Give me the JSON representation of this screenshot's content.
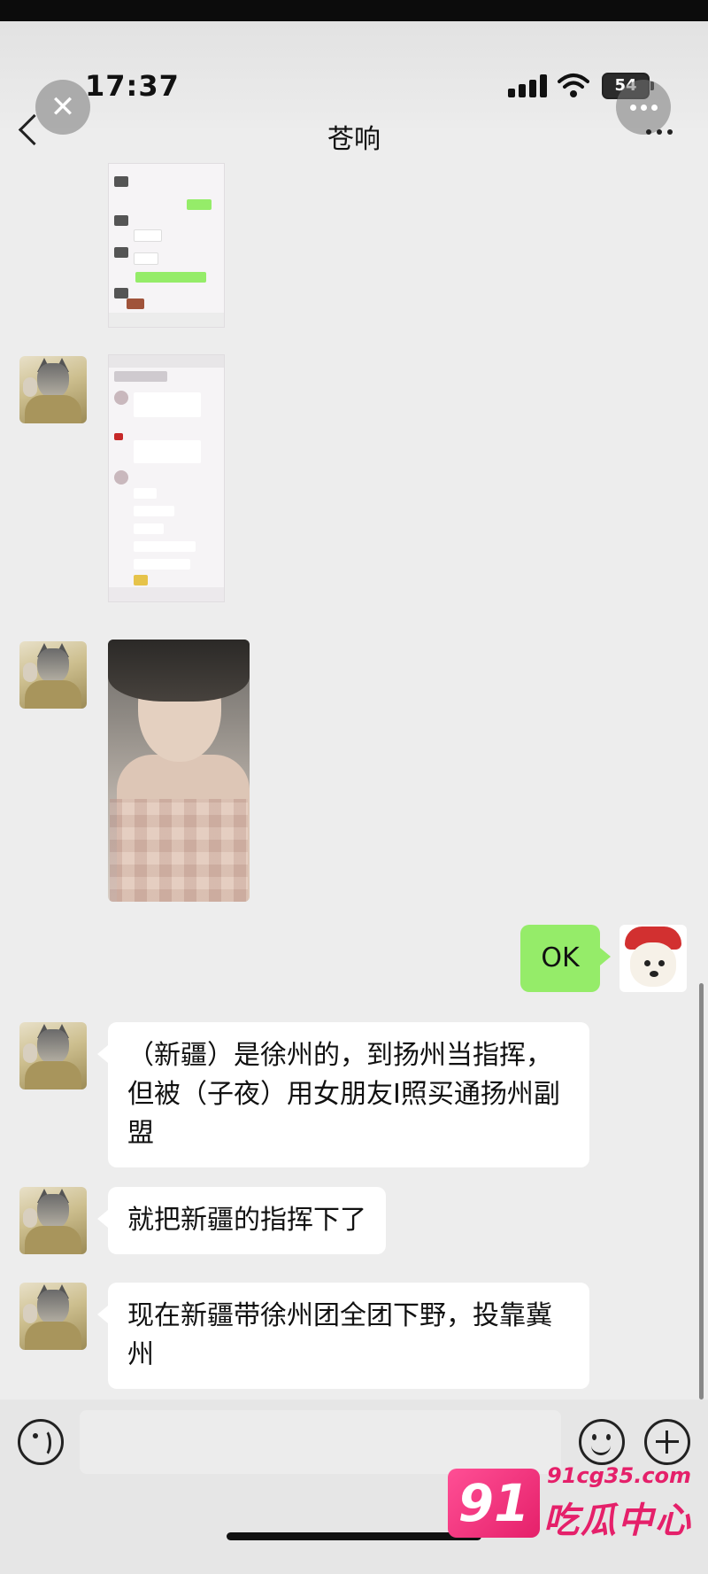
{
  "status_bar": {
    "time": "17:37",
    "battery": "54"
  },
  "header": {
    "title": "苍响"
  },
  "messages": [
    {
      "type": "image",
      "sender": "other",
      "content": "chat-screenshot"
    },
    {
      "type": "image",
      "sender": "other",
      "content": "chat-screenshot"
    },
    {
      "type": "image",
      "sender": "other",
      "content": "photo"
    },
    {
      "type": "text",
      "sender": "me",
      "text": "OK"
    },
    {
      "type": "text",
      "sender": "other",
      "text": "（新疆）是徐州的，到扬州当指挥，但被（子夜）用女朋友I照买通扬州副盟"
    },
    {
      "type": "text",
      "sender": "other",
      "text": "就把新疆的指挥下了"
    },
    {
      "type": "text",
      "sender": "other",
      "text": "现在新疆带徐州团全团下野，投靠冀州"
    }
  ],
  "input_bar": {
    "placeholder": ""
  },
  "watermark": {
    "logo": "91",
    "url": "91cg35.com",
    "name": "吃瓜中心"
  },
  "colors": {
    "my_bubble": "#95ec69",
    "other_bubble": "#ffffff",
    "background": "#ededed"
  },
  "icons": [
    "close-icon",
    "more-icon",
    "back-icon",
    "voice-icon",
    "emoji-icon",
    "plus-icon"
  ]
}
